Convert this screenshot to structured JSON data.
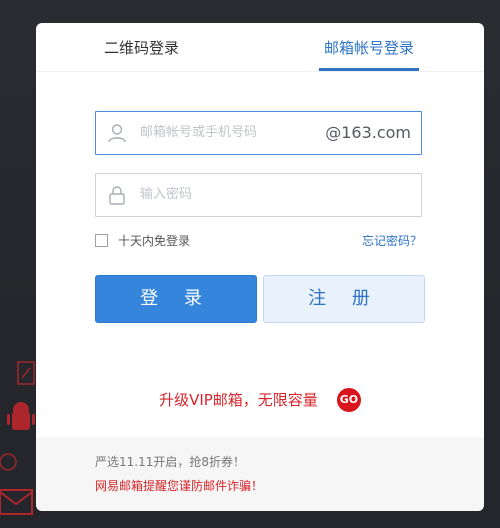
{
  "tabs": {
    "qr_login": "二维码登录",
    "mail_login": "邮箱帐号登录"
  },
  "form": {
    "username_placeholder": "邮箱帐号或手机号码",
    "domain_suffix": "@163.com",
    "password_placeholder": "输入密码",
    "remember_label": "十天内免登录",
    "forgot_label": "忘记密码？"
  },
  "buttons": {
    "login": "登 录",
    "register": "注 册"
  },
  "promo": {
    "text": "升级VIP邮箱，无限容量",
    "go": "GO"
  },
  "footer": {
    "notice1": "严选11.11开启，抢8折券！",
    "notice2": "网易邮箱提醒您谨防邮件诈骗！"
  },
  "colors": {
    "accent": "#2c72c7",
    "primary_button": "#3585dc",
    "secondary_button": "#e9f2fc",
    "alert_red": "#d8252b",
    "background": "#2a2c31"
  },
  "icons": {
    "username": "user-icon",
    "password": "lock-icon",
    "promo_go": "go-badge-icon"
  }
}
